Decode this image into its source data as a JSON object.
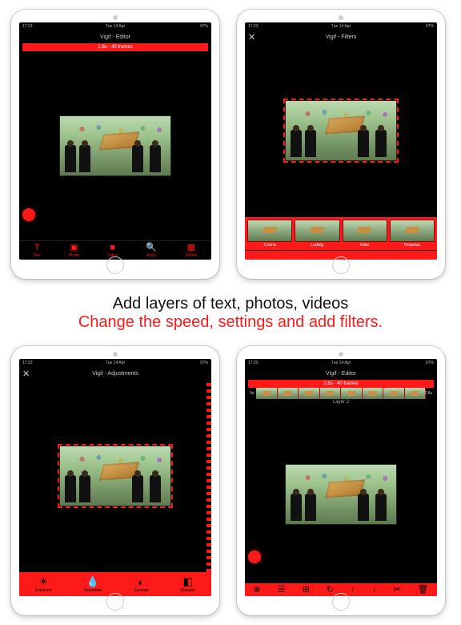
{
  "status": {
    "left": "17:23",
    "mid": "Tue 14 Apr",
    "right": "97%"
  },
  "screens": {
    "s1": {
      "title": "Vigif - Editor",
      "timebar": "2,8s - 40 frames",
      "tools": [
        {
          "icon": "T",
          "label": "Text"
        },
        {
          "icon": "▣",
          "label": "Photo"
        },
        {
          "icon": "■",
          "label": "Video"
        },
        {
          "icon": "🔍",
          "label": "Giphy"
        },
        {
          "icon": "▦",
          "label": "Sticker"
        }
      ]
    },
    "s2": {
      "title": "Vigif - Filters",
      "close": "✕",
      "filters": [
        {
          "label": "Crema"
        },
        {
          "label": "Ludwig"
        },
        {
          "label": "Aden"
        },
        {
          "label": "Perpetua"
        }
      ]
    },
    "s3": {
      "title": "Vigif - Adjustments",
      "close": "✕",
      "adjust": [
        {
          "icon": "☀",
          "label": "Exposure"
        },
        {
          "icon": "💧",
          "label": "Saturation"
        },
        {
          "icon": "◐",
          "label": "Contrast"
        },
        {
          "icon": "◧",
          "label": "Sharpen"
        }
      ]
    },
    "s4": {
      "title": "Vigif - Editor",
      "timebar": "2,8s - 40 frames",
      "edge_l": "0s",
      "edge_r": "2,8s",
      "layer": "Layer 2",
      "tools": [
        {
          "icon": "⊕"
        },
        {
          "icon": "☰"
        },
        {
          "icon": "⊞"
        },
        {
          "icon": "↻"
        },
        {
          "icon": "↑"
        },
        {
          "icon": "↓"
        },
        {
          "icon": "✂"
        },
        {
          "icon": "🗑"
        }
      ]
    }
  },
  "caption": {
    "line1": "Add layers of text, photos, videos",
    "line2": "Change the speed, settings and add filters."
  }
}
